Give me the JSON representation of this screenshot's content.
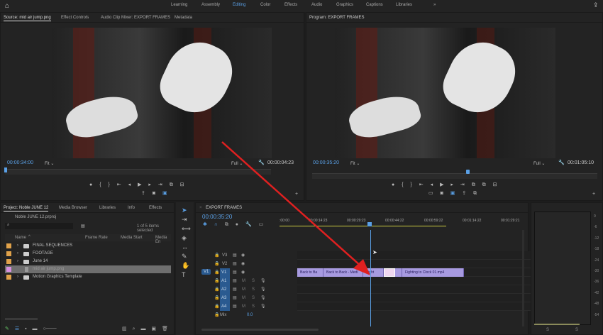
{
  "workspaces": [
    "Learning",
    "Assembly",
    "Editing",
    "Color",
    "Effects",
    "Audio",
    "Graphics",
    "Captions",
    "Libraries"
  ],
  "active_workspace": "Editing",
  "more": "»",
  "source": {
    "tabs": [
      "Source: mid air jump.png",
      "Effect Controls",
      "Audio Clip Mixer: EXPORT FRAMES",
      "Metadata"
    ],
    "timecode": "00:00:34:00",
    "fit": "Fit",
    "quality": "Full",
    "duration": "00:00:04:23"
  },
  "program": {
    "title": "Program: EXPORT FRAMES",
    "timecode": "00:00:35:20",
    "fit": "Fit",
    "quality": "Full",
    "duration": "00:01:05:10"
  },
  "project": {
    "tabs": [
      "Project: Noble JUNE 12",
      "Media Browser",
      "Libraries",
      "Info",
      "Effects"
    ],
    "file": "Noble JUNE 12.prproj",
    "selection": "1 of 5 items selected",
    "columns": [
      "Name",
      "Frame Rate",
      "Media Start",
      "Media En"
    ],
    "items": [
      {
        "name": "FINAL SEQUENCES",
        "color": "#e0a24a",
        "type": "folder"
      },
      {
        "name": "FOOTAGE",
        "color": "#e0a24a",
        "type": "folder"
      },
      {
        "name": "June 14",
        "color": "#e0a24a",
        "type": "folder"
      },
      {
        "name": "mid air jump.png",
        "color": "#d890e0",
        "type": "file"
      },
      {
        "name": "Motion Graphics Template",
        "color": "#e0a24a",
        "type": "folder"
      }
    ]
  },
  "timeline": {
    "title": "EXPORT FRAMES",
    "timecode": "00:00:35:20",
    "ruler": [
      ":00:00",
      "00:00:14:23",
      "00:00:29:23",
      "00:00:44:22",
      "00:00:59:22",
      "00:01:14:22",
      "00:01:29:21"
    ],
    "video_tracks": [
      "V3",
      "V2",
      "V1"
    ],
    "source_patch": "V1",
    "audio_tracks": [
      "A1",
      "A2",
      "A3",
      "A4"
    ],
    "mix_label": "Mix",
    "mix_value": "0.0",
    "clips": [
      "Back to Ba",
      "Back to Back - Medi",
      "Fight",
      "",
      "Fighting to Clock 01.mp4"
    ]
  },
  "meter": {
    "scale": [
      "0",
      "-6",
      "-12",
      "-18",
      "-24",
      "-30",
      "-36",
      "-42",
      "-48",
      "-54"
    ],
    "channels": [
      "S",
      "S"
    ]
  }
}
